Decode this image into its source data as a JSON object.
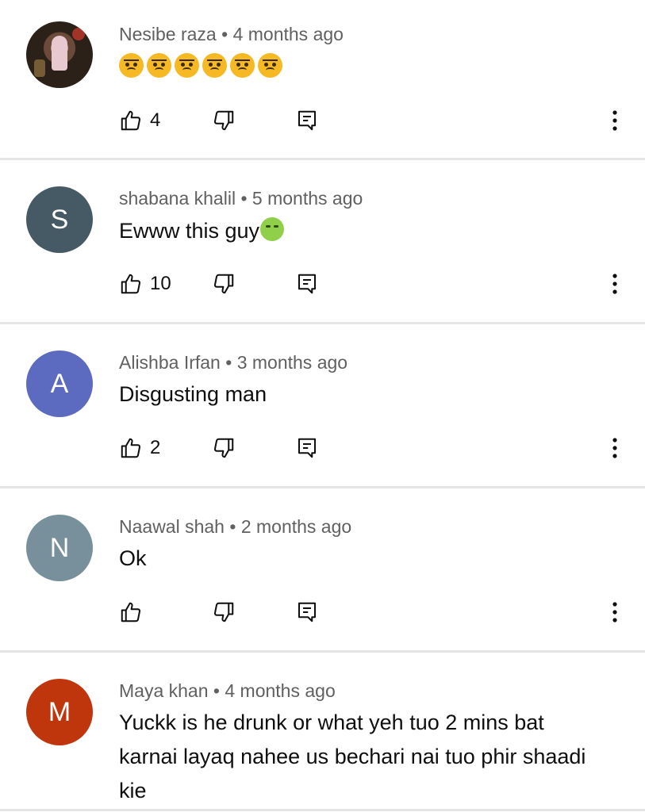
{
  "comments": [
    {
      "author": "Nesibe raza",
      "time": "4 months ago",
      "text": "",
      "likes": "4",
      "avatar_letter": "",
      "avatar_color": "#2b2119"
    },
    {
      "author": "shabana khalil",
      "time": "5 months ago",
      "text": "Ewww this guy",
      "likes": "10",
      "avatar_letter": "S",
      "avatar_color": "#455a64"
    },
    {
      "author": "Alishba Irfan",
      "time": "3 months ago",
      "text": "Disgusting man",
      "likes": "2",
      "avatar_letter": "A",
      "avatar_color": "#5c6bc0"
    },
    {
      "author": "Naawal shah",
      "time": "2 months ago",
      "text": "Ok",
      "likes": "",
      "avatar_letter": "N",
      "avatar_color": "#78909c"
    },
    {
      "author": "Maya khan",
      "time": "4 months ago",
      "text": "Yuckk is he drunk or what yeh tuo 2 mins bat karnai layaq nahee us bechari nai tuo phir shaadi kie",
      "likes": "",
      "avatar_letter": "M",
      "avatar_color": "#bf360c"
    }
  ],
  "separator": " • ",
  "icons": {
    "like": "thumb-up-icon",
    "dislike": "thumb-down-icon",
    "reply": "reply-icon",
    "more": "more-vert-icon"
  }
}
